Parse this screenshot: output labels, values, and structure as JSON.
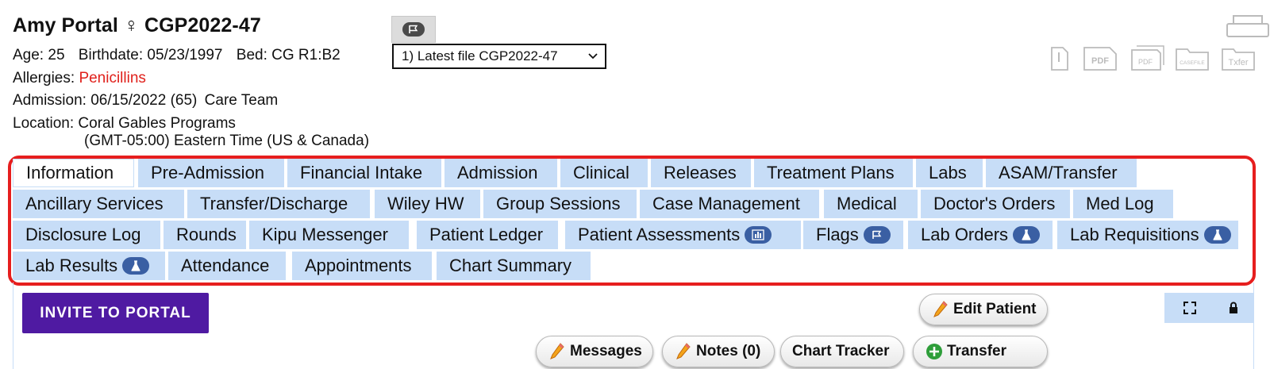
{
  "patient": {
    "name": "Amy Portal",
    "gender_symbol": "♀",
    "id": "CGP2022-47",
    "age_label": "Age:",
    "age": "25",
    "birthdate_label": "Birthdate:",
    "birthdate": "05/23/1997",
    "bed_label": "Bed:",
    "bed": "CG R1:B2",
    "allergies_label": "Allergies:",
    "allergies": "Penicillins",
    "admission_label": "Admission:",
    "admission": "06/15/2022 (65)",
    "care_team": "Care Team",
    "location_label": "Location:",
    "location": "Coral Gables Programs",
    "timezone": "(GMT-05:00) Eastern Time (US & Canada)"
  },
  "file_select": {
    "selected": "1) Latest file CGP2022-47"
  },
  "doc_icons": {
    "pdf1": "PDF",
    "pdf2": "PDF",
    "casefile": "CASEFILE",
    "txfer": "Txfer"
  },
  "tabs": [
    {
      "label": "Information",
      "active": true
    },
    {
      "label": "Pre-Admission"
    },
    {
      "label": "Financial Intake"
    },
    {
      "label": "Admission"
    },
    {
      "label": "Clinical"
    },
    {
      "label": "Releases"
    },
    {
      "label": "Treatment Plans"
    },
    {
      "label": "Labs"
    },
    {
      "label": "ASAM/Transfer"
    },
    {
      "label": "Ancillary Services"
    },
    {
      "label": "Transfer/Discharge"
    },
    {
      "label": "Wiley HW"
    },
    {
      "label": "Group Sessions"
    },
    {
      "label": "Case Management"
    },
    {
      "label": "Medical"
    },
    {
      "label": "Doctor's Orders"
    },
    {
      "label": "Med Log"
    },
    {
      "label": "Disclosure Log"
    },
    {
      "label": "Rounds"
    },
    {
      "label": "Kipu Messenger"
    },
    {
      "label": "Patient Ledger"
    },
    {
      "label": "Patient Assessments",
      "icon": "chart-icon"
    },
    {
      "label": "Flags",
      "icon": "flag-icon"
    },
    {
      "label": "Lab Orders",
      "icon": "flask-icon"
    },
    {
      "label": "Lab Requisitions",
      "icon": "flask-icon"
    },
    {
      "label": "Lab Results",
      "icon": "flask-icon"
    },
    {
      "label": "Attendance"
    },
    {
      "label": "Appointments"
    },
    {
      "label": "Chart Summary"
    }
  ],
  "actions": {
    "invite": "INVITE TO PORTAL",
    "edit_patient": "Edit Patient",
    "messages": "Messages",
    "notes": "Notes (0)",
    "chart_tracker": "Chart Tracker",
    "transfer": "Transfer"
  },
  "colors": {
    "tab_bg": "#c7ddf7",
    "highlight_border": "#e61e1e",
    "invite_bg": "#4f1aa2",
    "badge_bg": "#3a5fa3",
    "allergy_text": "#e0201b"
  }
}
